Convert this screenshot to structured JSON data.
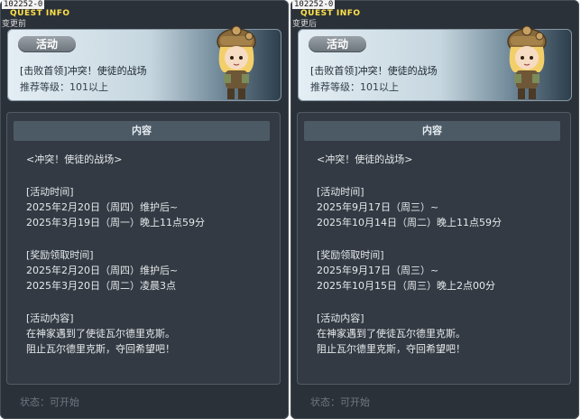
{
  "panels": [
    {
      "meta_id": "102252-0",
      "quest_info": "QUEST INFO",
      "state_label": "变更前",
      "badge": "活动",
      "title": "[击败首领]冲突！使徒的战场",
      "recommend": "推荐等级：101以上",
      "content_header": "内容",
      "lines": {
        "l1": "<冲突！使徒的战场>",
        "l2": "[活动时间]",
        "l3": "2025年2月20日（周四）维护后~",
        "l4": "2025年3月19日（周一）晚上11点59分",
        "l5": "[奖励领取时间]",
        "l6": "2025年2月20日（周四）维护后~",
        "l7": "2025年3月20日（周二）凌晨3点",
        "l8": "[活动内容]",
        "l9": "在神家遇到了使徒瓦尔德里克斯。",
        "l10": "阻止瓦尔德里克斯，夺回希望吧！"
      },
      "status": "状态：可开始"
    },
    {
      "meta_id": "102252-0",
      "quest_info": "QUEST INFO",
      "state_label": "变更后",
      "badge": "活动",
      "title": "[击败首领]冲突！使徒的战场",
      "recommend": "推荐等级：101以上",
      "content_header": "内容",
      "lines": {
        "l1": "<冲突！使徒的战场>",
        "l2": "[活动时间]",
        "l3": "2025年9月17日（周三）~",
        "l4": "2025年10月14日（周二）晚上11点59分",
        "l5": "[奖励领取时间]",
        "l6": "2025年9月17日（周三）~",
        "l7": "2025年10月15日（周三）晚上2点00分",
        "l8": "[活动内容]",
        "l9": "在神家遇到了使徒瓦尔德里克斯。",
        "l10": "阻止瓦尔德里克斯，夺回希望吧！"
      },
      "status": "状态：可开始"
    }
  ],
  "icons": {
    "npc": "npc-portrait-icon"
  },
  "colors": {
    "quest_info": "#ffe24a",
    "panel_bg": "#2b3139",
    "content_bg": "#333a43"
  }
}
